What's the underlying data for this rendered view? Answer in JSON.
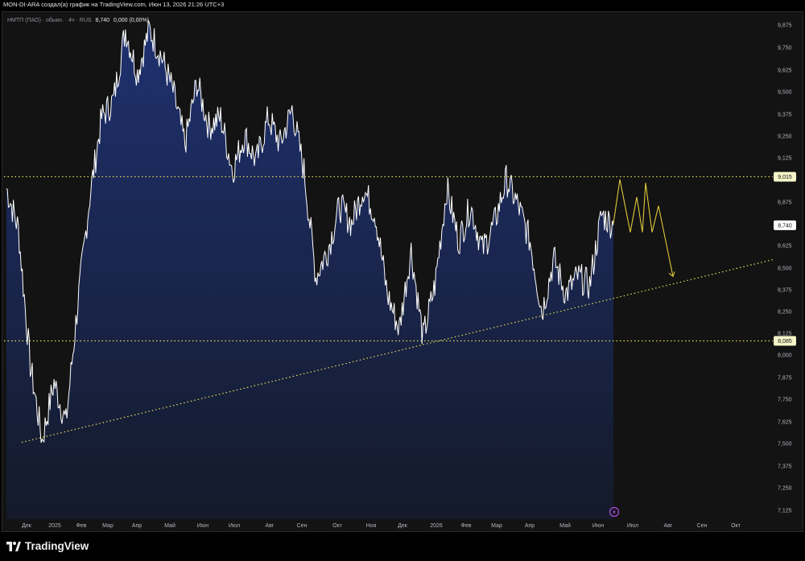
{
  "header": {
    "title": "MON-DI-ARA создал(а) график на TradingView.com, Июн 13, 2026 21:26 UTC+3"
  },
  "legend": {
    "symbol": "НМТП (ПАО) · обыкн. · 4ч · RUS",
    "value": "8,740",
    "change": "0,000 (0,00%)"
  },
  "brand": {
    "name": "TradingView",
    "icon": "tradingview-logo-icon"
  },
  "colors": {
    "background": "#131313",
    "area_fill": "#1b2647",
    "line": "#ffffff",
    "support_lines": "#e8e05a",
    "forecast": "#e0c73a",
    "label_yellow_bg": "#f5f5c8",
    "label_white_bg": "#ffffff",
    "event_icon": "#b34be0"
  },
  "chart_data": {
    "type": "area",
    "title": "",
    "xlabel": "",
    "ylabel": "",
    "ylim": [
      7.07,
      9.9
    ],
    "grid": false,
    "x_tick_labels": [
      "Дек",
      "2025",
      "Фев",
      "Мар",
      "Апр",
      "Май",
      "Июн",
      "Июл",
      "Авг",
      "Сен",
      "Окт",
      "Ноя",
      "Дек",
      "2026",
      "Фев",
      "Мар",
      "Апр",
      "Май",
      "Июн",
      "Июл",
      "Авг",
      "Сен",
      "Окт"
    ],
    "y_tick_labels": [
      "9,875",
      "9,750",
      "9,625",
      "9,500",
      "9,375",
      "9,250",
      "9,125",
      "9,000",
      "8,875",
      "8,750",
      "8,625",
      "8,500",
      "8,375",
      "8,250",
      "8,125",
      "8,000",
      "7,875",
      "7,750",
      "7,625",
      "7,500",
      "7,375",
      "7,250",
      "7,125"
    ],
    "series": [
      {
        "values_by_month": [
          [
            "Дек",
            8.95
          ],
          [
            "Дек",
            8.72
          ],
          [
            "Дек",
            7.95
          ],
          [
            "Дек",
            7.52
          ],
          [
            "Дек",
            7.85
          ],
          [
            "Дек",
            7.62
          ],
          [
            "2025",
            8.3
          ],
          [
            "2025",
            8.9
          ],
          [
            "2025",
            9.35
          ],
          [
            "Фев",
            9.45
          ],
          [
            "Фев",
            9.85
          ],
          [
            "Фев",
            9.6
          ],
          [
            "Мар",
            9.85
          ],
          [
            "Мар",
            9.7
          ],
          [
            "Мар",
            9.5
          ],
          [
            "Апр",
            9.2
          ],
          [
            "Апр",
            9.55
          ],
          [
            "Апр",
            9.3
          ],
          [
            "Май",
            9.35
          ],
          [
            "Май",
            9.05
          ],
          [
            "Май",
            9.25
          ],
          [
            "Июн",
            9.1
          ],
          [
            "Июн",
            9.35
          ],
          [
            "Июн",
            9.2
          ],
          [
            "Июл",
            9.4
          ],
          [
            "Июл",
            9.05
          ],
          [
            "Июл",
            8.45
          ],
          [
            "Авг",
            8.6
          ],
          [
            "Авг",
            8.85
          ],
          [
            "Авг",
            8.75
          ],
          [
            "Сен",
            8.95
          ],
          [
            "Сен",
            8.8
          ],
          [
            "Окт",
            8.35
          ],
          [
            "Окт",
            8.15
          ],
          [
            "Ноя",
            8.6
          ],
          [
            "Ноя",
            8.1
          ],
          [
            "Ноя",
            8.4
          ],
          [
            "Дек",
            8.95
          ],
          [
            "Дек",
            8.65
          ],
          [
            "2026",
            8.85
          ],
          [
            "2026",
            8.6
          ],
          [
            "Фев",
            8.75
          ],
          [
            "Фев",
            9.0
          ],
          [
            "Мар",
            8.85
          ],
          [
            "Мар",
            8.65
          ],
          [
            "Апр",
            8.25
          ],
          [
            "Апр",
            8.55
          ],
          [
            "Май",
            8.35
          ],
          [
            "Май",
            8.45
          ],
          [
            "Июн",
            8.4
          ],
          [
            "Июн",
            8.8
          ],
          [
            "Июн",
            8.74
          ]
        ]
      }
    ],
    "horizontal_levels": [
      {
        "value": 9.015,
        "label": "9,015"
      },
      {
        "value": 8.085,
        "label": "8,085"
      }
    ],
    "current_price": {
      "value": 8.74,
      "label": "8,740"
    },
    "trendline": {
      "from": [
        "Дек",
        7.51
      ],
      "to": [
        "Сен",
        8.6
      ]
    },
    "forecast_path": [
      [
        "Июн",
        8.75
      ],
      [
        "Июл",
        9.0
      ],
      [
        "Июл",
        8.7
      ],
      [
        "Июл",
        8.9
      ],
      [
        "Июл",
        8.7
      ],
      [
        "Июл",
        8.98
      ],
      [
        "Июл",
        8.7
      ],
      [
        "Авг",
        8.85
      ],
      [
        "Авг",
        8.45
      ]
    ]
  }
}
